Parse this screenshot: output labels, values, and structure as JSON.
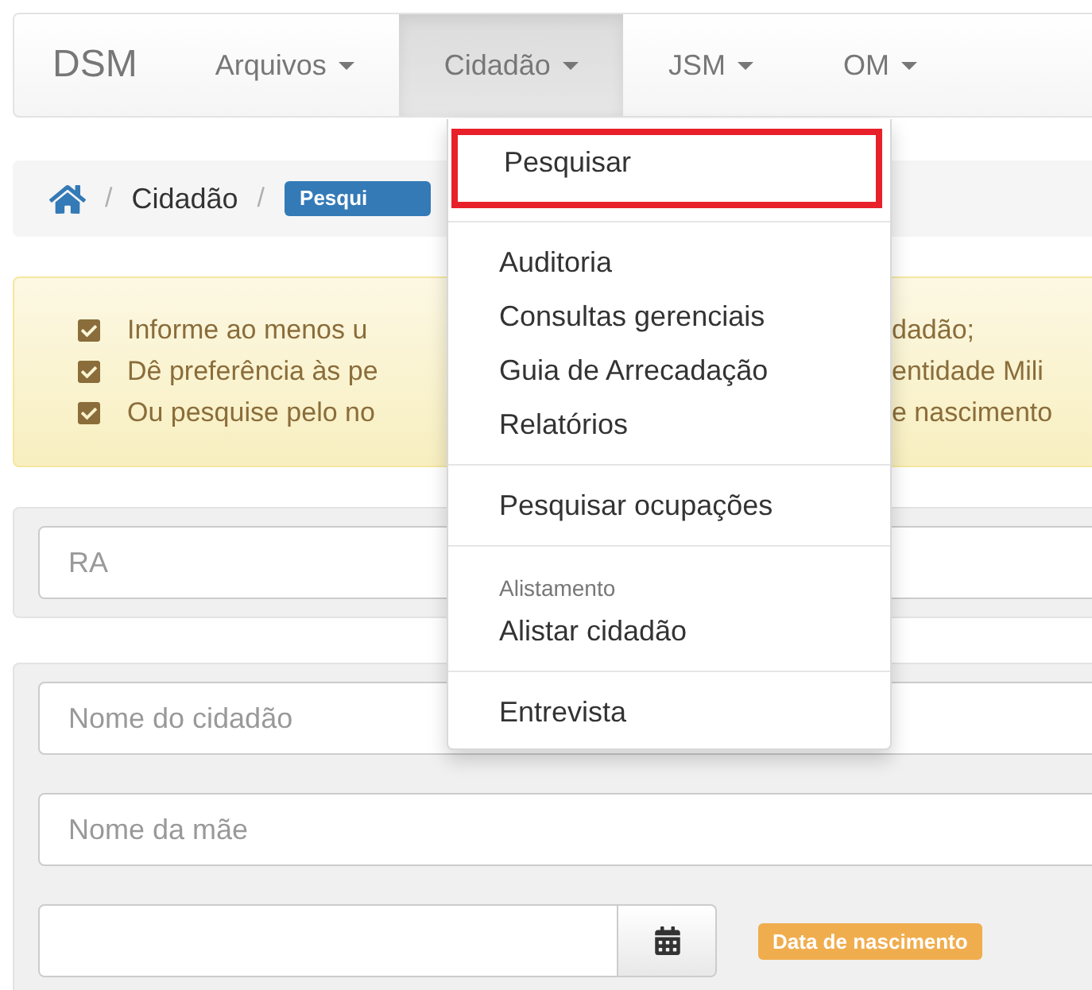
{
  "navbar": {
    "brand": "DSM",
    "items": [
      {
        "label": "Arquivos",
        "selected": false
      },
      {
        "label": "Cidadão",
        "selected": true
      },
      {
        "label": "JSM",
        "selected": false
      },
      {
        "label": "OM",
        "selected": false
      }
    ]
  },
  "breadcrumb": {
    "items": [
      {
        "separator": "/",
        "label": "Cidadão"
      }
    ],
    "separator": "/",
    "current": "Pesqui"
  },
  "alert": {
    "lines": [
      {
        "left": "Informe ao menos u",
        "right": "dadão;",
        "checked": true
      },
      {
        "left": "Dê preferência às pe",
        "right": "entidade Mili",
        "checked": true
      },
      {
        "left": "Ou pesquise pelo no",
        "right": "e nascimento",
        "checked": true
      }
    ]
  },
  "dropdown": {
    "items": [
      {
        "kind": "item",
        "label": "Pesquisar",
        "highlighted": true
      },
      {
        "kind": "divider"
      },
      {
        "kind": "item",
        "label": "Auditoria",
        "highlighted": false
      },
      {
        "kind": "item",
        "label": "Consultas gerenciais",
        "highlighted": false
      },
      {
        "kind": "item",
        "label": "Guia de Arrecadação",
        "highlighted": false
      },
      {
        "kind": "item",
        "label": "Relatórios",
        "highlighted": false
      },
      {
        "kind": "divider"
      },
      {
        "kind": "item",
        "label": "Pesquisar ocupações",
        "highlighted": false
      },
      {
        "kind": "divider"
      },
      {
        "kind": "header",
        "label": "Alistamento"
      },
      {
        "kind": "item",
        "label": "Alistar cidadão",
        "highlighted": false
      },
      {
        "kind": "divider"
      },
      {
        "kind": "item",
        "label": "Entrevista",
        "highlighted": false
      }
    ]
  },
  "search_panel": {
    "fields": [
      {
        "placeholder": "RA"
      }
    ]
  },
  "citizen_panel": {
    "name_field": {
      "placeholder": "Nome do cidadão"
    },
    "mother_field": {
      "placeholder": "Nome da mãe"
    },
    "birth_date": {
      "label": "Data de nascimento"
    }
  }
}
